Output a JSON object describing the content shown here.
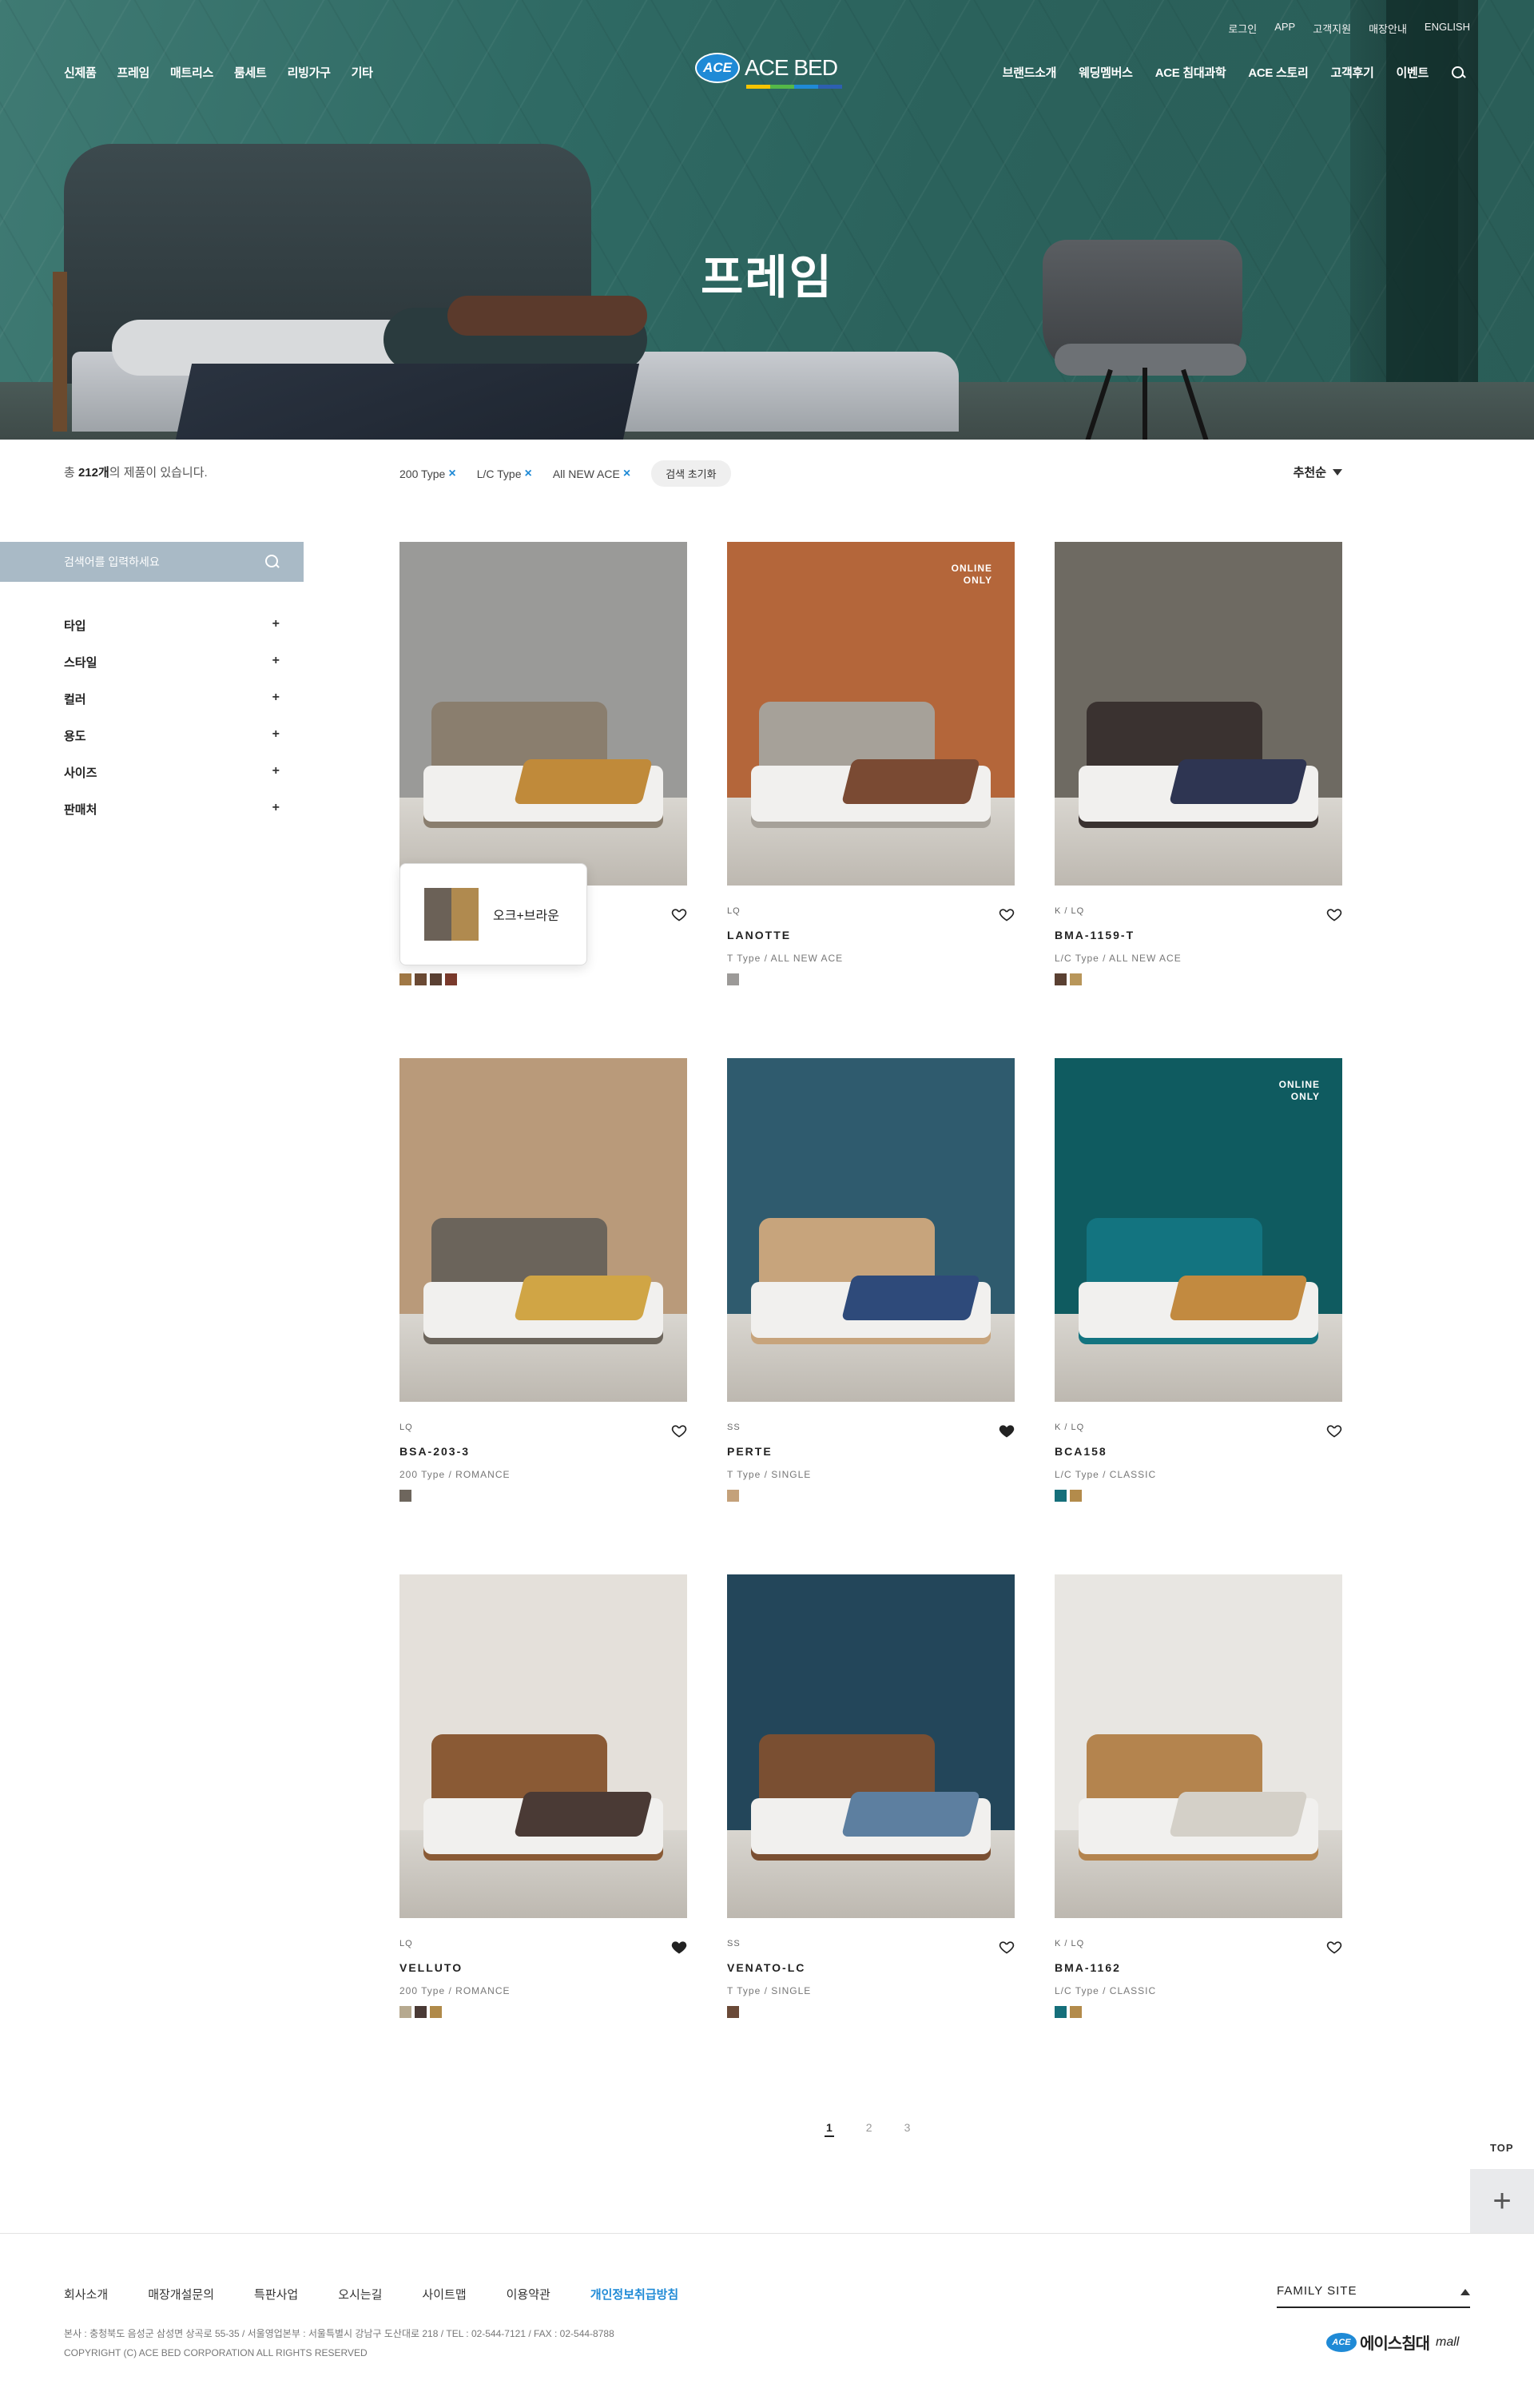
{
  "header": {
    "utility_links": [
      "로그인",
      "APP",
      "고객지원",
      "매장안내",
      "ENGLISH"
    ],
    "nav_left": [
      "신제품",
      "프레임",
      "매트리스",
      "룸세트",
      "리빙가구",
      "기타"
    ],
    "nav_right": [
      "브랜드소개",
      "웨딩멤버스",
      "ACE 침대과학",
      "ACE 스토리",
      "고객후기",
      "이벤트"
    ],
    "logo_badge": "ACE",
    "logo_text": "ACE BED",
    "search_icon": "search-icon"
  },
  "hero": {
    "title": "프레임"
  },
  "filter": {
    "total_prefix": "총 ",
    "total_count": "212개",
    "total_suffix": "의 제품이 있습니다.",
    "chips": [
      "200 Type",
      "L/C Type",
      "All NEW ACE"
    ],
    "chip_close": "×",
    "reset_label": "검색 초기화",
    "sort_label": "추천순"
  },
  "sidebar": {
    "search_placeholder": "검색어를 입력하세요",
    "categories": [
      "타입",
      "스타일",
      "컬러",
      "용도",
      "사이즈",
      "판매처"
    ],
    "plus": "+"
  },
  "tooltip": {
    "label": "오크+브라운",
    "colors": [
      "#6b6157",
      "#b08a4f"
    ]
  },
  "products": [
    {
      "size": "",
      "name": "",
      "type": "",
      "online": "",
      "liked": false,
      "swatches": [
        "#a07845",
        "#6b4a34",
        "#5a4033",
        "#7a3a2c"
      ],
      "wall": "#9a9a98",
      "accent": "#c08a3a",
      "head": "#8a7e6e"
    },
    {
      "size": "LQ",
      "name": "LANOTTE",
      "type": "T Type / ALL NEW ACE",
      "online": "ONLINE\nONLY",
      "liked": false,
      "swatches": [
        "#9c9a98"
      ],
      "wall": "#b4663a",
      "accent": "#7a4a33",
      "head": "#a6a199"
    },
    {
      "size": "K / LQ",
      "name": "BMA-1159-T",
      "type": "L/C Type / ALL NEW ACE",
      "online": "",
      "liked": false,
      "swatches": [
        "#5a4032",
        "#b8965a"
      ],
      "wall": "#6e6a62",
      "accent": "#2e3552",
      "head": "#3a3230"
    },
    {
      "size": "LQ",
      "name": "BSA-203-3",
      "type": "200 Type / ROMANCE",
      "online": "",
      "liked": false,
      "swatches": [
        "#6e665d"
      ],
      "wall": "#b99a7a",
      "accent": "#d0a545",
      "head": "#6b645b"
    },
    {
      "size": "SS",
      "name": "PERTE",
      "type": "T Type / SINGLE",
      "online": "",
      "liked": true,
      "swatches": [
        "#c4a17a"
      ],
      "wall": "#2f5b6e",
      "accent": "#2e4a7a",
      "head": "#c7a47c"
    },
    {
      "size": "K / LQ",
      "name": "BCA158",
      "type": "L/C Type / CLASSIC",
      "online": "ONLINE\nONLY",
      "liked": false,
      "swatches": [
        "#156f7a",
        "#b38b4b"
      ],
      "wall": "#0f5b60",
      "accent": "#c28a40",
      "head": "#137480"
    },
    {
      "size": "LQ",
      "name": "VELLUTO",
      "type": "200 Type / ROMANCE",
      "online": "",
      "liked": true,
      "swatches": [
        "#b6a98f",
        "#4a3a35",
        "#b08a4a"
      ],
      "wall": "#e4e0da",
      "accent": "#4a3a35",
      "head": "#8a5a35"
    },
    {
      "size": "SS",
      "name": "VENATO-LC",
      "type": "T Type / SINGLE",
      "online": "",
      "liked": false,
      "swatches": [
        "#6a4a38"
      ],
      "wall": "#23465a",
      "accent": "#5d7fa0",
      "head": "#7a4f32"
    },
    {
      "size": "K / LQ",
      "name": "BMA-1162",
      "type": "L/C Type / CLASSIC",
      "online": "",
      "liked": false,
      "swatches": [
        "#156f7a",
        "#b38b4b"
      ],
      "wall": "#e8e6e2",
      "accent": "#d4d0c8",
      "head": "#b4844e"
    }
  ],
  "pagination": {
    "pages": [
      "1",
      "2",
      "3"
    ],
    "current": "1"
  },
  "top_button": "TOP",
  "add_button": "+",
  "footer": {
    "links": [
      "회사소개",
      "매장개설문의",
      "특판사업",
      "오시는길",
      "사이트맵",
      "이용약관",
      "개인정보취급방침"
    ],
    "address": "본사 : 충청북도 음성군 삼성면 상곡로 55-35  / 서울영업본부 : 서울특별시 강남구 도산대로 218 / TEL : 02-544-7121 / FAX : 02-544-8788",
    "copyright": "COPYRIGHT (C) ACE BED CORPORATION ALL RIGHTS RESERVED",
    "family_site": "FAMILY SITE",
    "mall_badge": "ACE",
    "mall_name": "에이스침대",
    "mall_suffix": "mall"
  }
}
